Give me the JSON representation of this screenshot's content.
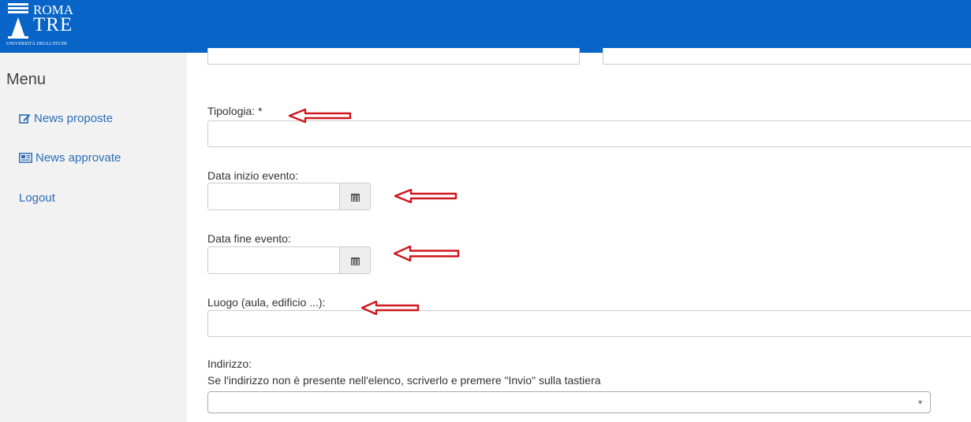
{
  "brand": {
    "line1": "ROMA",
    "line2": "TRE",
    "line3": "UNIVERSITÀ DEGLI STUDI"
  },
  "sidebar": {
    "title": "Menu",
    "items": [
      {
        "label": "News proposte",
        "icon": "edit-icon"
      },
      {
        "label": "News approvate",
        "icon": "newspaper-icon"
      },
      {
        "label": "Logout",
        "icon": ""
      }
    ]
  },
  "form": {
    "tipologia_label": "Tipologia: *",
    "tipologia_value": "",
    "data_inizio_label": "Data inizio evento:",
    "data_inizio_value": "",
    "data_fine_label": "Data fine evento:",
    "data_fine_value": "",
    "luogo_label": "Luogo (aula, edificio ...):",
    "luogo_value": "",
    "indirizzo_label": "Indirizzo:",
    "indirizzo_hint": "Se l'indirizzo non è presente nell'elenco, scriverlo e premere \"Invio\" sulla tastiera",
    "indirizzo_value": ""
  },
  "icons": {
    "calendar": "calendar-icon",
    "caret": "chevron-down-icon",
    "annotation": "red-arrow-icon"
  },
  "colors": {
    "header": "#0864c6",
    "link": "#2a6eb8",
    "annotation": "#d0161e"
  }
}
